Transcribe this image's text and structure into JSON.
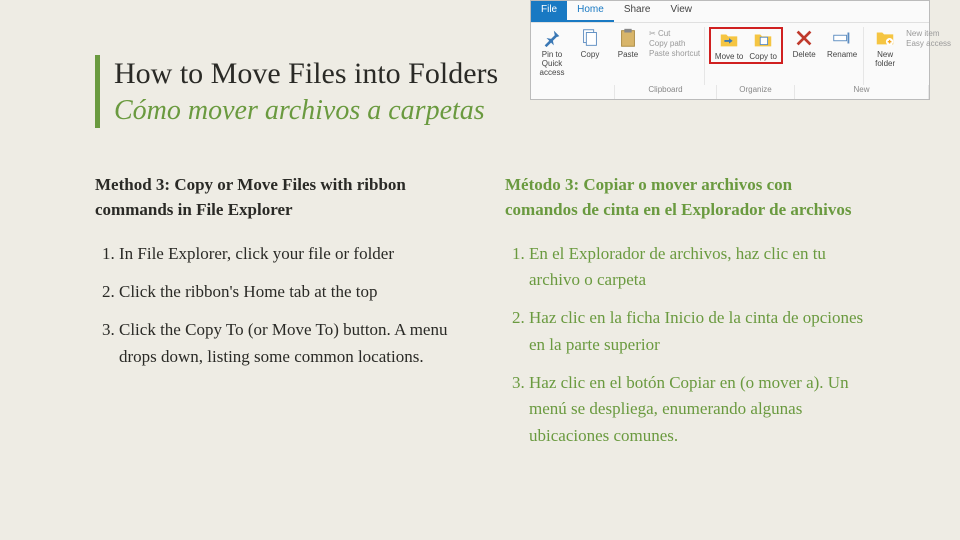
{
  "title_en": "How to Move Files into Folders",
  "title_es": "Cómo mover archivos a carpetas",
  "left": {
    "heading": "Method 3: Copy or Move Files with ribbon commands in File Explorer",
    "items": [
      "In File Explorer, click your file or folder",
      "Click the ribbon's Home tab at the top",
      "Click the Copy To (or Move To) button. A menu drops down, listing some common locations."
    ]
  },
  "right": {
    "heading": "Método 3: Copiar o mover archivos con comandos de cinta en el Explorador de archivos",
    "items": [
      "En el Explorador de archivos, haz clic en tu archivo o carpeta",
      "Haz clic en la ficha Inicio de la cinta de opciones en la parte superior",
      "Haz clic en el botón Copiar en (o mover a). Un menú se despliega, enumerando algunas ubicaciones comunes."
    ]
  },
  "ribbon": {
    "tabs": {
      "file": "File",
      "home": "Home",
      "share": "Share",
      "view": "View"
    },
    "buttons": {
      "pin": "Pin to Quick access",
      "copy": "Copy",
      "paste": "Paste",
      "cut": "Cut",
      "copypath": "Copy path",
      "pasteshort": "Paste shortcut",
      "moveto": "Move to",
      "copyto": "Copy to",
      "delete": "Delete",
      "rename": "Rename",
      "newfolder": "New folder",
      "newitem": "New item",
      "easyaccess": "Easy access"
    },
    "groups": {
      "clipboard": "Clipboard",
      "organize": "Organize",
      "new": "New"
    }
  }
}
